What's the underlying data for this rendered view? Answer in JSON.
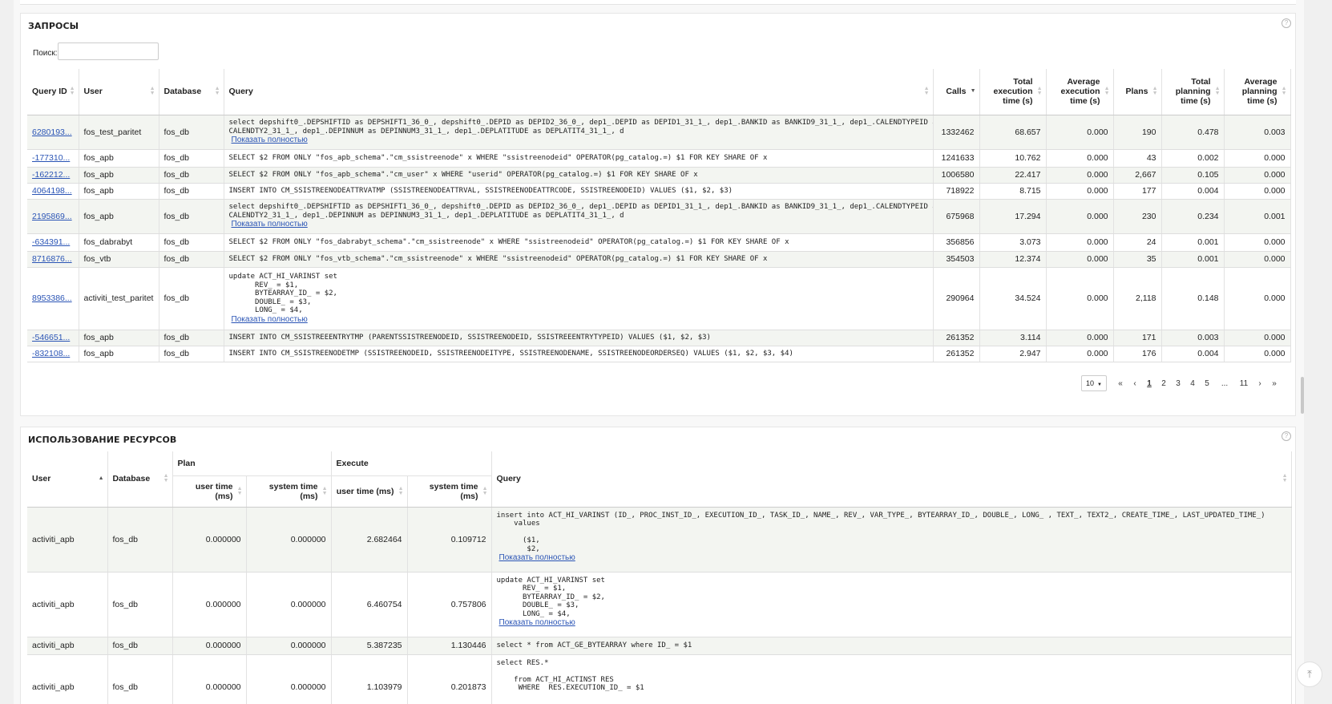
{
  "queries_panel": {
    "title": "ЗАПРОСЫ",
    "help_icon": "?",
    "search_label": "Поиск:",
    "search_value": "",
    "columns": [
      "Query ID",
      "User",
      "Database",
      "Query",
      "Calls",
      "Total execution time (s)",
      "Average execution time (s)",
      "Plans",
      "Total planning time (s)",
      "Average planning time (s)"
    ],
    "show_full_label": "Показать полностью",
    "rows": [
      {
        "id": "6280193...",
        "user": "fos_test_paritet",
        "db": "fos_db",
        "query": "select depshift0_.DEPSHIFTID as DEPSHIFT1_36_0_, depshift0_.DEPID as DEPID2_36_0_, dep1_.DEPID as DEPID1_31_1_, dep1_.BANKID as BANKID9_31_1_, dep1_.CALENDTYPEID as\nCALENDTY2_31_1_, dep1_.DEPINNUM as DEPINNUM3_31_1_, dep1_.DEPLATITUDE as DEPLATIT4_31_1_, d",
        "show_full": true,
        "calls": "1332462",
        "total_exec": "68.657",
        "avg_exec": "0.000",
        "plans": "190",
        "total_plan": "0.478",
        "avg_plan": "0.003"
      },
      {
        "id": "-177310...",
        "user": "fos_apb",
        "db": "fos_db",
        "query": "SELECT $2 FROM ONLY \"fos_apb_schema\".\"cm_ssistreenode\" x WHERE \"ssistreenodeid\" OPERATOR(pg_catalog.=) $1 FOR KEY SHARE OF x",
        "show_full": false,
        "calls": "1241633",
        "total_exec": "10.762",
        "avg_exec": "0.000",
        "plans": "43",
        "total_plan": "0.002",
        "avg_plan": "0.000"
      },
      {
        "id": "-162212...",
        "user": "fos_apb",
        "db": "fos_db",
        "query": "SELECT $2 FROM ONLY \"fos_apb_schema\".\"cm_user\" x WHERE \"userid\" OPERATOR(pg_catalog.=) $1 FOR KEY SHARE OF x",
        "show_full": false,
        "calls": "1006580",
        "total_exec": "22.417",
        "avg_exec": "0.000",
        "plans": "2,667",
        "total_plan": "0.105",
        "avg_plan": "0.000"
      },
      {
        "id": "4064198...",
        "user": "fos_apb",
        "db": "fos_db",
        "query": "INSERT INTO CM_SSISTREENODEATTRVATMP (SSISTREENODEATTRVAL, SSISTREENODEATTRCODE, SSISTREENODEID) VALUES ($1, $2, $3)",
        "show_full": false,
        "calls": "718922",
        "total_exec": "8.715",
        "avg_exec": "0.000",
        "plans": "177",
        "total_plan": "0.004",
        "avg_plan": "0.000"
      },
      {
        "id": "2195869...",
        "user": "fos_apb",
        "db": "fos_db",
        "query": "select depshift0_.DEPSHIFTID as DEPSHIFT1_36_0_, depshift0_.DEPID as DEPID2_36_0_, dep1_.DEPID as DEPID1_31_1_, dep1_.BANKID as BANKID9_31_1_, dep1_.CALENDTYPEID as\nCALENDTY2_31_1_, dep1_.DEPINNUM as DEPINNUM3_31_1_, dep1_.DEPLATITUDE as DEPLATIT4_31_1_, d",
        "show_full": true,
        "calls": "675968",
        "total_exec": "17.294",
        "avg_exec": "0.000",
        "plans": "230",
        "total_plan": "0.234",
        "avg_plan": "0.001"
      },
      {
        "id": "-634391...",
        "user": "fos_dabrabyt",
        "db": "fos_db",
        "query": "SELECT $2 FROM ONLY \"fos_dabrabyt_schema\".\"cm_ssistreenode\" x WHERE \"ssistreenodeid\" OPERATOR(pg_catalog.=) $1 FOR KEY SHARE OF x",
        "show_full": false,
        "calls": "356856",
        "total_exec": "3.073",
        "avg_exec": "0.000",
        "plans": "24",
        "total_plan": "0.001",
        "avg_plan": "0.000"
      },
      {
        "id": "8716876...",
        "user": "fos_vtb",
        "db": "fos_db",
        "query": "SELECT $2 FROM ONLY \"fos_vtb_schema\".\"cm_ssistreenode\" x WHERE \"ssistreenodeid\" OPERATOR(pg_catalog.=) $1 FOR KEY SHARE OF x",
        "show_full": false,
        "calls": "354503",
        "total_exec": "12.374",
        "avg_exec": "0.000",
        "plans": "35",
        "total_plan": "0.001",
        "avg_plan": "0.000"
      },
      {
        "id": "8953386...",
        "user": "activiti_test_paritet",
        "db": "fos_db",
        "query": "update ACT_HI_VARINST set\n      REV_ = $1,\n      BYTEARRAY_ID_ = $2,\n      DOUBLE_ = $3,\n      LONG_ = $4,",
        "show_full": true,
        "calls": "290964",
        "total_exec": "34.524",
        "avg_exec": "0.000",
        "plans": "2,118",
        "total_plan": "0.148",
        "avg_plan": "0.000"
      },
      {
        "id": "-546651...",
        "user": "fos_apb",
        "db": "fos_db",
        "query": "INSERT INTO CM_SSISTREEENTRYTMP (PARENTSSISTREENODEID, SSISTREENODEID, SSISTREEENTRYTYPEID) VALUES ($1, $2, $3)",
        "show_full": false,
        "calls": "261352",
        "total_exec": "3.114",
        "avg_exec": "0.000",
        "plans": "171",
        "total_plan": "0.003",
        "avg_plan": "0.000"
      },
      {
        "id": "-832108...",
        "user": "fos_apb",
        "db": "fos_db",
        "query": "INSERT INTO CM_SSISTREENODETMP (SSISTREENODEID, SSISTREENODEITYPE, SSISTREENODENAME, SSISTREENODEORDERSEQ) VALUES ($1, $2, $3, $4)",
        "show_full": false,
        "calls": "261352",
        "total_exec": "2.947",
        "avg_exec": "0.000",
        "plans": "176",
        "total_plan": "0.004",
        "avg_plan": "0.000"
      }
    ],
    "pager": {
      "page_size": "10",
      "first": "«",
      "prev": "‹",
      "pages": [
        "1",
        "2",
        "3",
        "4",
        "5"
      ],
      "ellipsis": "...",
      "last_page": "11",
      "next": "›",
      "last": "»",
      "current": "1"
    }
  },
  "resources_panel": {
    "title": "ИСПОЛЬЗОВАНИЕ РЕСУРСОВ",
    "help_icon": "?",
    "group_plan": "Plan",
    "group_execute": "Execute",
    "col_user": "User",
    "col_database": "Database",
    "col_plan_user": "user time (ms)",
    "col_plan_system": "system time (ms)",
    "col_exec_user": "user time (ms)",
    "col_exec_system": "system time (ms)",
    "col_query": "Query",
    "show_full_label": "Показать полностью",
    "rows": [
      {
        "user": "activiti_apb",
        "db": "fos_db",
        "plan_user": "0.000000",
        "plan_sys": "0.000000",
        "exec_user": "2.682464",
        "exec_sys": "0.109712",
        "query": "insert into ACT_HI_VARINST (ID_, PROC_INST_ID_, EXECUTION_ID_, TASK_ID_, NAME_, REV_, VAR_TYPE_, BYTEARRAY_ID_, DOUBLE_, LONG_ , TEXT_, TEXT2_, CREATE_TIME_, LAST_UPDATED_TIME_)\n    values\n\n      ($1,\n       $2,",
        "show_full": true
      },
      {
        "user": "activiti_apb",
        "db": "fos_db",
        "plan_user": "0.000000",
        "plan_sys": "0.000000",
        "exec_user": "6.460754",
        "exec_sys": "0.757806",
        "query": "update ACT_HI_VARINST set\n      REV_ = $1,\n      BYTEARRAY_ID_ = $2,\n      DOUBLE_ = $3,\n      LONG_ = $4,",
        "show_full": true
      },
      {
        "user": "activiti_apb",
        "db": "fos_db",
        "plan_user": "0.000000",
        "plan_sys": "0.000000",
        "exec_user": "5.387235",
        "exec_sys": "1.130446",
        "query": "select * from ACT_GE_BYTEARRAY where ID_ = $1",
        "show_full": false
      },
      {
        "user": "activiti_apb",
        "db": "fos_db",
        "plan_user": "0.000000",
        "plan_sys": "0.000000",
        "exec_user": "1.103979",
        "exec_sys": "0.201873",
        "query": "select RES.*\n\n    from ACT_HI_ACTINST RES\n     WHERE  RES.EXECUTION_ID_ = $1",
        "show_full": false
      }
    ]
  },
  "totop_icon": "⤒"
}
